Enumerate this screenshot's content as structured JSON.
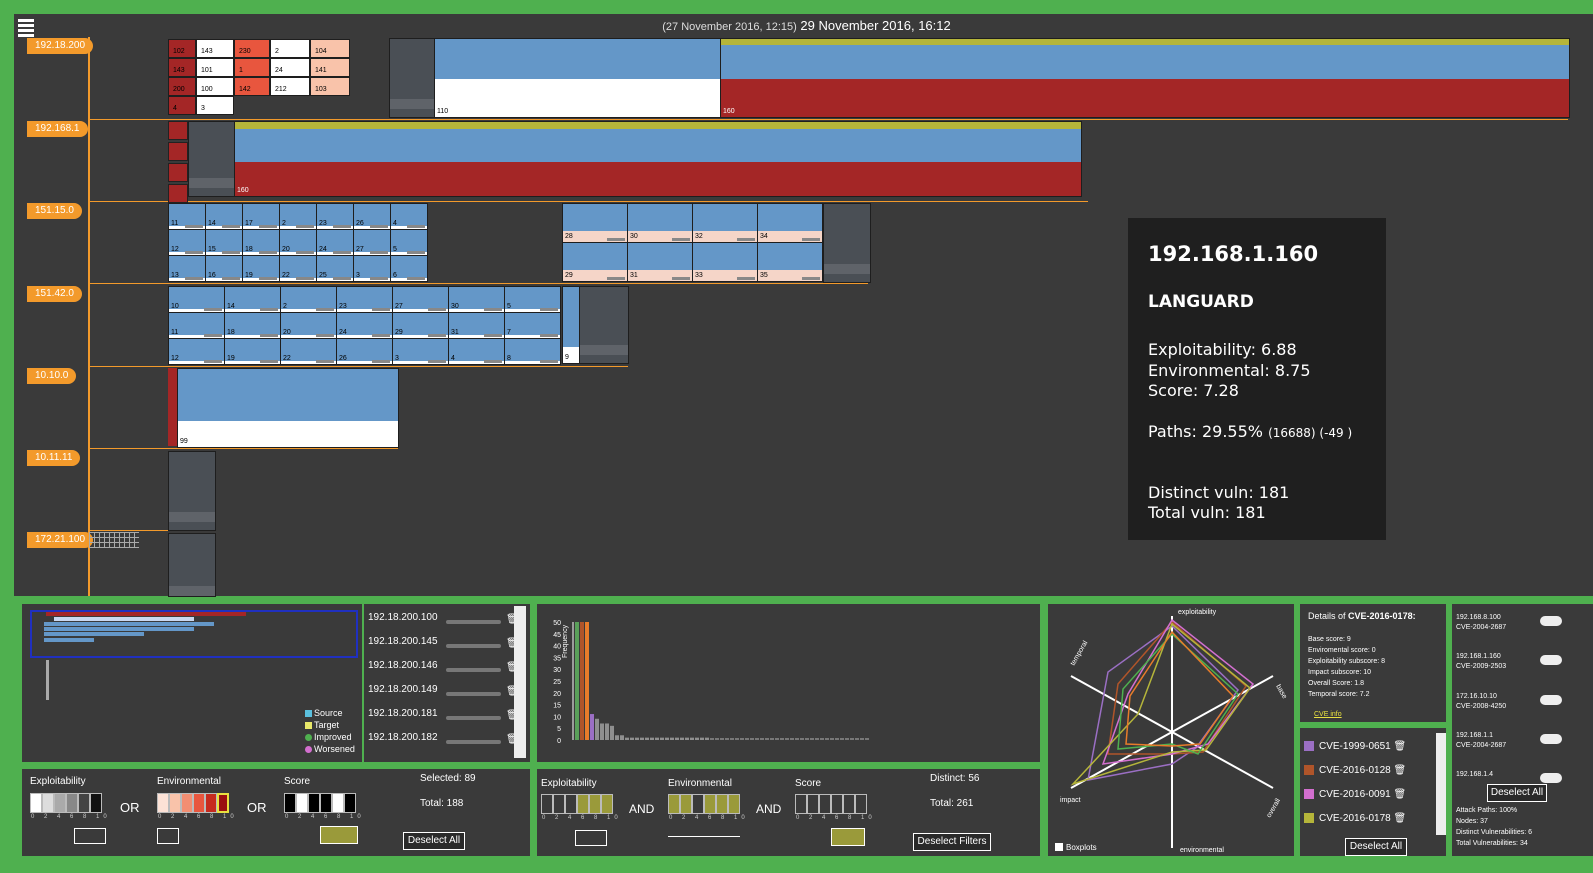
{
  "header": {
    "previous_time": "(27 November 2016, 12:15)",
    "current_time": "29 November 2016, 16:12"
  },
  "subnets": [
    {
      "label": "192.18.200"
    },
    {
      "label": "192.168.1"
    },
    {
      "label": "151.15.0"
    },
    {
      "label": "151.42.0"
    },
    {
      "label": "10.10.0"
    },
    {
      "label": "10.11.11"
    },
    {
      "label": "172.21.100"
    }
  ],
  "hosts": {
    "s1_small": [
      "102",
      "143",
      "230",
      "2",
      "104",
      "143",
      "101",
      "1",
      "24",
      "141",
      "200",
      "100",
      "142",
      "212",
      "103",
      "4",
      "3"
    ],
    "s1_big": [
      "110",
      "160"
    ],
    "s2_big": [
      "160"
    ],
    "s3": [
      "11",
      "14",
      "17",
      "2",
      "23",
      "26",
      "4",
      "12",
      "15",
      "18",
      "20",
      "24",
      "27",
      "5",
      "13",
      "16",
      "19",
      "22",
      "25",
      "3",
      "6",
      "28",
      "30",
      "32",
      "34",
      "29",
      "31",
      "33",
      "35"
    ],
    "s4": [
      "10",
      "14",
      "2",
      "23",
      "27",
      "30",
      "5",
      "11",
      "18",
      "20",
      "24",
      "29",
      "31",
      "7",
      "12",
      "19",
      "22",
      "26",
      "3",
      "4",
      "8",
      "9"
    ],
    "s5": [
      "99"
    ]
  },
  "tooltip": {
    "ip": "192.168.1.160",
    "name": "LANGUARD",
    "exploitability": "Exploitability: 6.88",
    "environmental": "Environmental: 8.75",
    "score": "Score: 7.28",
    "paths_main": "Paths: 29.55%",
    "paths_detail": "(16688) (-49 )",
    "distinct": "Distinct vuln: 181",
    "total": "Total vuln: 181"
  },
  "overview_legend": {
    "source": "Source",
    "target": "Target",
    "improved": "Improved",
    "worsened": "Worsened"
  },
  "host_list": [
    "192.18.200.100",
    "192.18.200.145",
    "192.18.200.146",
    "192.18.200.149",
    "192.18.200.181",
    "192.18.200.182"
  ],
  "frequency_chart": {
    "ylabel": "Frequency",
    "yticks": [
      "50",
      "45",
      "40",
      "35",
      "30",
      "25",
      "20",
      "15",
      "10",
      "5",
      "0"
    ]
  },
  "chart_data": {
    "type": "bar",
    "ylabel": "Frequency",
    "ylim": [
      0,
      50
    ],
    "series": [
      {
        "values": [
          50,
          50,
          50,
          11,
          9,
          7,
          7,
          6,
          2,
          2,
          1,
          1,
          1,
          1,
          1,
          1,
          1,
          1,
          1,
          1,
          1,
          1,
          1,
          1,
          1,
          1,
          1
        ]
      }
    ],
    "colors": [
      "#5aa05a",
      "#b0552a",
      "#e87c2a",
      "#9b6fc4",
      "#8f8f8f"
    ]
  },
  "radar": {
    "axes": [
      "exploitability",
      "base",
      "overall",
      "environmental",
      "impact",
      "temporal"
    ],
    "boxplots_label": "Boxplots"
  },
  "details": {
    "title_prefix": "Details of ",
    "cve": "CVE-2016-0178:",
    "lines": [
      "Base score: 9",
      "Enviromental score: 0",
      "Exploitability subscore: 8",
      "Impact subscore: 10",
      "Overall Score: 1.8",
      "Temporal score: 7.2"
    ],
    "link": "CVE info"
  },
  "cve_list": [
    {
      "id": "CVE-1999-0651",
      "color": "#9b6fc4",
      "checked": false
    },
    {
      "id": "CVE-2016-0128",
      "color": "#b0552a",
      "checked": false
    },
    {
      "id": "CVE-2016-0091",
      "color": "#d36fcf",
      "checked": false
    },
    {
      "id": "CVE-2016-0178",
      "color": "#b5b53a",
      "checked": true
    }
  ],
  "cve_deselect": "Deselect All",
  "right_list": [
    {
      "host": "192.168.8.100",
      "cve": "CVE-2004-2687"
    },
    {
      "host": "192.168.1.160",
      "cve": "CVE-2009-2503"
    },
    {
      "host": "172.16.10.10",
      "cve": "CVE-2008-4250"
    },
    {
      "host": "192.168.1.1",
      "cve": "CVE-2004-2687"
    },
    {
      "host": "192.168.1.4",
      "cve": ""
    }
  ],
  "right_deselect": "Deselect All",
  "right_stats": [
    "Attack Paths: 100%",
    "Nodes: 37",
    "Distinct Vulnerabilities: 6",
    "Total Vulnerabilities: 34"
  ],
  "host_filter": {
    "exploitability": "Exploitability",
    "environmental": "Environmental",
    "score": "Score",
    "or": "OR",
    "selected": "Selected: 89",
    "total": "Total: 188",
    "deselect": "Deselect All",
    "ticks": "0 2 4 6 8 10"
  },
  "vuln_filter": {
    "exploitability": "Exploitability",
    "environmental": "Environmental",
    "score": "Score",
    "and": "AND",
    "distinct": "Distinct: 56",
    "total": "Total: 261",
    "deselect": "Deselect Filters",
    "ticks": "0 2 4 6 8 10"
  }
}
